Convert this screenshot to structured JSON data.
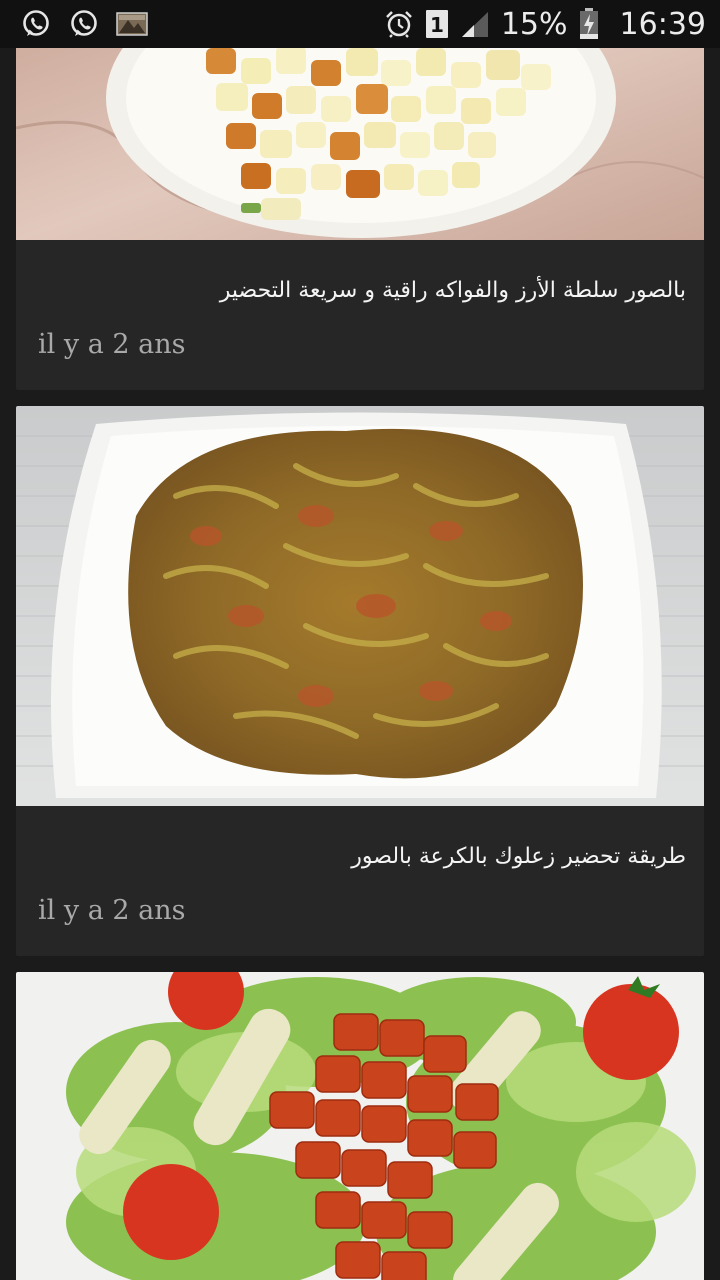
{
  "status_bar": {
    "battery_text": "15%",
    "clock": "16:39",
    "sim_label": "1",
    "icons": [
      "whatsapp-icon",
      "whatsapp-icon",
      "gallery-icon",
      "alarm-icon",
      "sim-icon",
      "signal-icon",
      "battery-charging-icon"
    ]
  },
  "feed": {
    "items": [
      {
        "title": "بالصور سلطة الأرز والفواكه راقية و سريعة التحضير",
        "time": "il y a 2 ans"
      },
      {
        "title": "طريقة تحضير زعلوك بالكرعة بالصور",
        "time": "il y a 2 ans"
      },
      {
        "title": "",
        "time": ""
      }
    ]
  }
}
